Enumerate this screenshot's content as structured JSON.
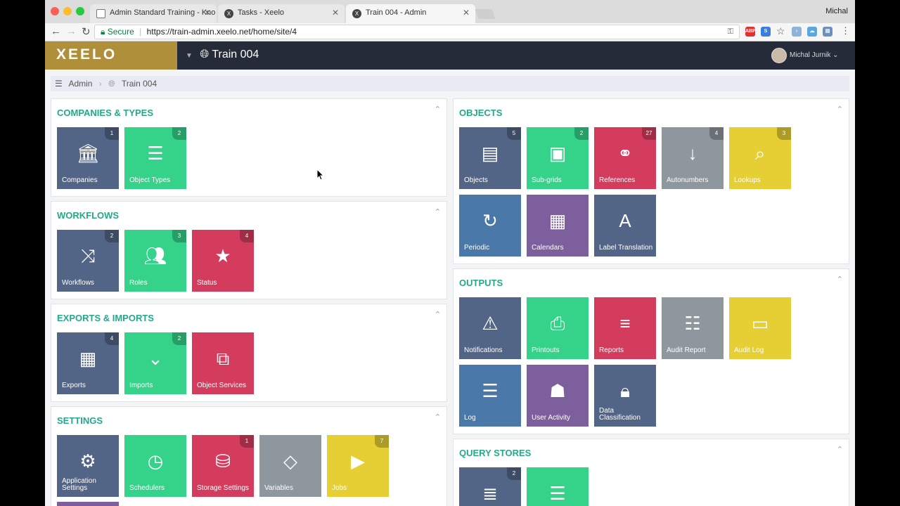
{
  "browser": {
    "tabs": [
      {
        "title": "Admin Standard Training - Kno"
      },
      {
        "title": "Tasks - Xeelo"
      },
      {
        "title": "Train 004 - Admin"
      }
    ],
    "profile_name": "Michal",
    "secure_label": "Secure",
    "url": "https://train-admin.xeelo.net/home/site/4"
  },
  "header": {
    "logo": "XEELO",
    "site_title": "Train 004",
    "user_name": "Michal Jurnik"
  },
  "breadcrumb": [
    "Admin",
    "Train 004"
  ],
  "panels": {
    "companies": {
      "title": "COMPANIES & TYPES",
      "tiles": [
        {
          "label": "Companies",
          "badge": "1",
          "color": "#536586",
          "icon": "bank-icon"
        },
        {
          "label": "Object Types",
          "badge": "2",
          "color": "#35d28a",
          "icon": "list-icon"
        }
      ]
    },
    "workflows": {
      "title": "WORKFLOWS",
      "tiles": [
        {
          "label": "Workflows",
          "badge": "2",
          "color": "#536586",
          "icon": "shuffle-icon"
        },
        {
          "label": "Roles",
          "badge": "3",
          "color": "#35d28a",
          "icon": "users-icon"
        },
        {
          "label": "Status",
          "badge": "4",
          "color": "#d33c5d",
          "icon": "star-icon"
        }
      ]
    },
    "exports": {
      "title": "EXPORTS & IMPORTS",
      "tiles": [
        {
          "label": "Exports",
          "badge": "4",
          "color": "#536586",
          "icon": "table-icon"
        },
        {
          "label": "Imports",
          "badge": "2",
          "color": "#35d28a",
          "icon": "chevrons-down-icon"
        },
        {
          "label": "Object Services",
          "badge": "",
          "color": "#d33c5d",
          "icon": "puzzle-icon"
        }
      ]
    },
    "settings": {
      "title": "SETTINGS",
      "tiles": [
        {
          "label": "Application Settings",
          "badge": "",
          "color": "#536586",
          "icon": "gears-icon"
        },
        {
          "label": "Schedulers",
          "badge": "",
          "color": "#35d28a",
          "icon": "clock-icon"
        },
        {
          "label": "Storage Settings",
          "badge": "1",
          "color": "#d33c5d",
          "icon": "database-icon"
        },
        {
          "label": "Variables",
          "badge": "",
          "color": "#8e969e",
          "icon": "code-icon"
        },
        {
          "label": "Jobs",
          "badge": "7",
          "color": "#e6cf34",
          "icon": "play-icon"
        }
      ]
    },
    "objects": {
      "title": "OBJECTS",
      "tiles": [
        {
          "label": "Objects",
          "badge": "5",
          "color": "#536586",
          "icon": "file-icon"
        },
        {
          "label": "Sub-grids",
          "badge": "2",
          "color": "#35d28a",
          "icon": "qrcode-icon"
        },
        {
          "label": "References",
          "badge": "27",
          "color": "#d33c5d",
          "icon": "link-icon"
        },
        {
          "label": "Autonumbers",
          "badge": "4",
          "color": "#8e969e",
          "icon": "sort-numeric-icon"
        },
        {
          "label": "Lookups",
          "badge": "3",
          "color": "#e6cf34",
          "icon": "search-icon"
        },
        {
          "label": "Periodic",
          "badge": "",
          "color": "#4a78a8",
          "icon": "refresh-icon"
        },
        {
          "label": "Calendars",
          "badge": "",
          "color": "#7c5f9c",
          "icon": "calendar-icon"
        },
        {
          "label": "Label Translation",
          "badge": "",
          "color": "#536586",
          "icon": "translate-icon"
        }
      ]
    },
    "outputs": {
      "title": "OUTPUTS",
      "tiles": [
        {
          "label": "Notifications",
          "badge": "",
          "color": "#536586",
          "icon": "warning-icon"
        },
        {
          "label": "Printouts",
          "badge": "",
          "color": "#35d28a",
          "icon": "printer-icon"
        },
        {
          "label": "Reports",
          "badge": "",
          "color": "#d33c5d",
          "icon": "bars-icon"
        },
        {
          "label": "Audit Report",
          "badge": "",
          "color": "#8e969e",
          "icon": "numbered-list-icon"
        },
        {
          "label": "Audit Log",
          "badge": "",
          "color": "#e6cf34",
          "icon": "card-icon"
        },
        {
          "label": "Log",
          "badge": "",
          "color": "#4a78a8",
          "icon": "server-icon"
        },
        {
          "label": "User Activity",
          "badge": "",
          "color": "#7c5f9c",
          "icon": "spy-icon"
        },
        {
          "label": "Data Classification",
          "badge": "",
          "color": "#536586",
          "icon": "lock-icon"
        }
      ]
    },
    "query_stores": {
      "title": "QUERY STORES",
      "tiles": [
        {
          "label": "",
          "badge": "2",
          "color": "#536586",
          "icon": "stack-icon"
        },
        {
          "label": "",
          "badge": "",
          "color": "#35d28a",
          "icon": "server-icon"
        }
      ]
    }
  }
}
